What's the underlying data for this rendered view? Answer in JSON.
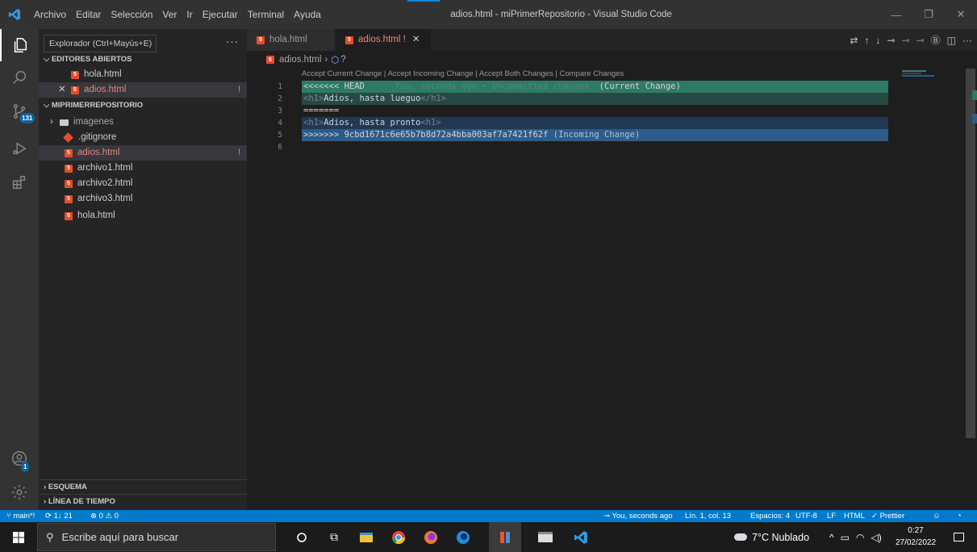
{
  "titlebar": {
    "menu": [
      "Archivo",
      "Editar",
      "Selección",
      "Ver",
      "Ir",
      "Ejecutar",
      "Terminal",
      "Ayuda"
    ],
    "window_title": "adios.html - miPrimerRepositorio - Visual Studio Code"
  },
  "activity": {
    "scm_badge": "131",
    "account_badge": "1"
  },
  "sidebar": {
    "tooltip": "Explorador (Ctrl+Mayús+E)",
    "open_editors_header": "EDITORES ABIERTOS",
    "open_editors": [
      {
        "name": "hola.html"
      },
      {
        "name": "adios.html",
        "modified_mark": "!"
      }
    ],
    "repo_header": "MIPRIMERREPOSITORIO",
    "tree": [
      {
        "name": "imagenes"
      },
      {
        "name": ".gitignore"
      },
      {
        "name": "adios.html",
        "modified_mark": "!"
      },
      {
        "name": "archivo1.html"
      },
      {
        "name": "archivo2.html"
      },
      {
        "name": "archivo3.html"
      },
      {
        "name": "hola.html"
      }
    ],
    "outline_header": "ESQUEMA",
    "timeline_header": "LÍNEA DE TIEMPO"
  },
  "tabs": [
    {
      "label": "hola.html"
    },
    {
      "label": "adios.html",
      "modified_mark": "!"
    }
  ],
  "breadcrumb": {
    "file": "adios.html",
    "symbol": "?"
  },
  "editor": {
    "codelens": "Accept Current Change | Accept Incoming Change | Accept Both Changes | Compare Changes",
    "lines": [
      {
        "n": "1",
        "marker": "<<<<<<< HEAD",
        "blame": "You, seconds ago • Uncommitted changes",
        "note": "(Current Change)"
      },
      {
        "n": "2",
        "open_tag": "<h1>",
        "text": "Adios, hasta lueguo",
        "close_tag": "</h1>"
      },
      {
        "n": "3",
        "marker": "======="
      },
      {
        "n": "4",
        "open_tag": "<h1>",
        "text": "Adios, hasta pronto",
        "close_tag": "<h1>"
      },
      {
        "n": "5",
        "marker": ">>>>>>> 9cbd1671c6e65b7b8d72a4bba003af7a7421f62f",
        "note": "(Incoming Change)"
      },
      {
        "n": "6"
      }
    ]
  },
  "statusbar": {
    "branch": "main*!",
    "sync": "1↓ 21",
    "errors": "0",
    "warnings": "0",
    "blame": "You, seconds ago",
    "position": "Lín. 1, col. 13",
    "spaces": "Espacios: 4",
    "encoding": "UTF-8",
    "eol": "LF",
    "language": "HTML",
    "prettier": "Prettier"
  },
  "taskbar": {
    "search_placeholder": "Escribe aquí para buscar",
    "weather": "7°C Nublado",
    "time": "0:27",
    "date": "27/02/2022"
  },
  "colors": {
    "accent": "#007acc",
    "current_change": "#2f7a65",
    "incoming_change": "#2d5b8a",
    "modified": "#e2887b",
    "html_icon": "#e44d26"
  }
}
